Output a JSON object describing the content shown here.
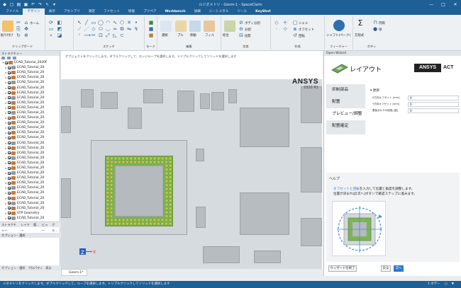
{
  "window": {
    "title": "ルジオメトリ - Geom-1 - SpaceClaim"
  },
  "ribbon_tabs": [
    {
      "label": "ファイル",
      "active": false
    },
    {
      "label": "デザイン",
      "active": true
    },
    {
      "label": "表示",
      "active": false
    },
    {
      "label": "アセンブリ",
      "active": false
    },
    {
      "label": "測定",
      "active": false
    },
    {
      "label": "ファセット",
      "active": false
    },
    {
      "label": "修復",
      "active": false
    },
    {
      "label": "プリペア",
      "active": false
    },
    {
      "label": "Workbench",
      "active": false
    },
    {
      "label": "詳細",
      "active": false
    },
    {
      "label": "シートメタル",
      "active": false
    },
    {
      "label": "ツール",
      "active": false
    },
    {
      "label": "KeyShot",
      "active": false
    }
  ],
  "ribbon": {
    "groups": {
      "clipboard": "クリップボード",
      "sketch": "スケッチ",
      "mode": "モード",
      "edit": "編集",
      "intersect": "交差",
      "create": "作成",
      "feature": "フィーチャー",
      "body": "ボディ"
    },
    "labels": {
      "paste": "貼り付け",
      "home": "ホーム",
      "select": "選択",
      "pull": "プル",
      "move": "移動",
      "fill": "フィル",
      "combine": "結合",
      "split_body": "ボディ分割",
      "split": "分割",
      "project": "投影",
      "shell": "シェル",
      "offset": "オフセット",
      "revolve": "回転",
      "shaft": "シャフト(ペーク)",
      "equation": "方程式",
      "cylinder": "円筒",
      "sphere": "球"
    }
  },
  "left_panel": {
    "structure_title": "ストラクチャー",
    "tree_items": [
      "ECAD_Tutorial_2020F",
      "ECAD_Tutorial_20",
      "ECAD_Tutorial_20",
      "ECAD_Tutorial_20",
      "ECAD_Tutorial_20",
      "ECAD_Tutorial_20",
      "ECAD_Tutorial_20",
      "ECAD_Tutorial_20",
      "ECAD_Tutorial_20",
      "ECAD_Tutorial_20",
      "ECAD_Tutorial_20",
      "ECAD_Tutorial_20",
      "ECAD_Tutorial_20",
      "ECAD_Tutorial_20",
      "ECAD_Tutorial_20",
      "ECAD_Tutorial_20",
      "ECAD_Tutorial_20",
      "ECAD_Tutorial_20",
      "ECAD_Tutorial_20",
      "ECAD_Tutorial_20",
      "ECAD_Tutorial_20",
      "ECAD_Tutorial_20",
      "ECAD_Tutorial_20",
      "ECAD_Tutorial_20",
      "ECAD_Tutorial_20",
      "ECAD_Tutorial_20",
      "ECAD_Tutorial_20",
      "ECAD_Tutorial_20",
      "ECAD_Tutorial_20",
      "ECAD_Tutorial_20",
      "STP Geometry",
      "ECAD_Tutorial_20"
    ],
    "panel_tabs": [
      "ストラクチャー",
      "レイヤー",
      "選...",
      "ビュー",
      "グル..."
    ],
    "options_title": "オプション - 選択",
    "bottom_tabs": [
      "オプション - 選択",
      "プロパティ",
      "表示"
    ]
  },
  "viewport": {
    "hint": "オブジェクトをクリックします。ダブルクリックして、エッジループを選択します。トリプルクリックしてソリッドを選択します",
    "ansys_brand": "ANSYS",
    "ansys_version": "2020 R1",
    "triad_x": "X",
    "triad_z": "Z",
    "doc_tab": "Geom-1*"
  },
  "wizard": {
    "panel_title": "Open Wizard",
    "banner_title": "レイアウト",
    "act_brand": "ANSYS",
    "act_label": "ACT",
    "steps": [
      "抑制部品",
      "配置",
      "プレビュー/調整",
      "配置確定"
    ],
    "active_step_index": 2,
    "form_section": "更新",
    "fields": [
      {
        "label": "X方向オフセット [mm]",
        "value": "0"
      },
      {
        "label": "Y方向オフセット [mm]",
        "value": "0"
      },
      {
        "label": "基板まわりの回転 [度]",
        "value": "0"
      }
    ],
    "help_header": "ヘルプ",
    "help_line1_highlight": "オフセットと回転",
    "help_line1_rest": "を入力して位置と角度を調整します。",
    "help_line2": "位置が決まれば[次へ]ボタンで確認ステップに進みます。",
    "exit_button": "ウィザードを終了",
    "back_button": "戻る",
    "next_button": "次へ"
  },
  "statusbar": {
    "text": "ジオメトリをクリックします。ダブルクリックして、ループを選択します。トリプルクリックしてソリッドを選択します",
    "right_items": [
      "1 ボデー",
      "□",
      "▼"
    ]
  },
  "colors": {
    "accent": "#1e5f96",
    "primary_button": "#2b7bd1",
    "board": "#d6dbdf",
    "pad_green": "#5aa040"
  }
}
